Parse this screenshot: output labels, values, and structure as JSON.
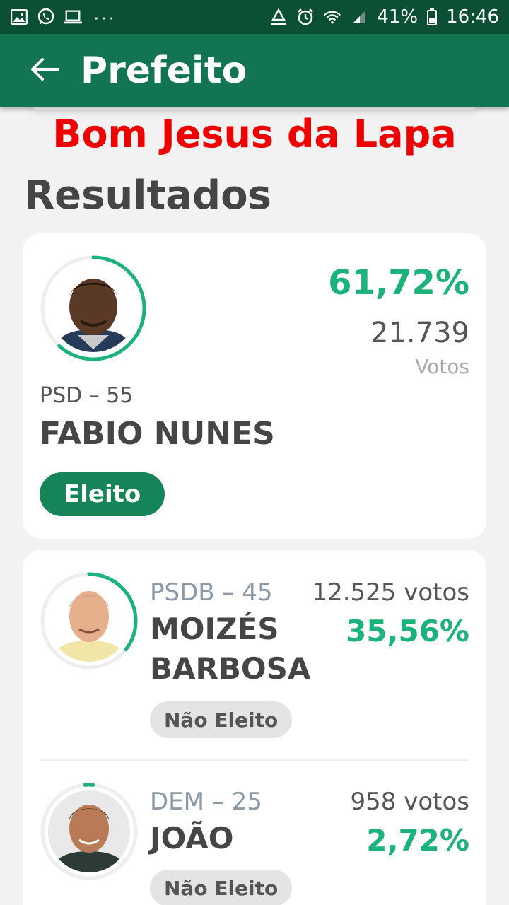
{
  "status_bar": {
    "battery": "41%",
    "time": "16:46",
    "left_icons": [
      "image-icon",
      "whatsapp-icon",
      "laptop-icon",
      "more-dots-icon"
    ],
    "right_icons": [
      "recycle-icon",
      "alarm-icon",
      "wifi-icon",
      "signal-icon",
      "battery-icon"
    ]
  },
  "app_bar": {
    "title": "Prefeito",
    "back_icon": "arrow-left-icon"
  },
  "city": "Bom Jesus da Lapa",
  "section_title": "Resultados",
  "colors": {
    "accent_green": "#1bb37a",
    "app_bar": "#137452",
    "status_bar": "#0b4f35",
    "city_red": "#ee0000",
    "elected_badge": "#168459"
  },
  "winner": {
    "percent": "61,72%",
    "percent_value": 61.72,
    "votes": "21.739",
    "votes_label": "Votos",
    "party": "PSD – 55",
    "name": "FABIO NUNES",
    "status": "Eleito"
  },
  "candidates": [
    {
      "party": "PSDB – 45",
      "name": "MOIZÉS BARBOSA",
      "votes": "12.525 votos",
      "percent": "35,56%",
      "percent_value": 35.56,
      "status": "Não Eleito"
    },
    {
      "party": "DEM – 25",
      "name": "JOÃO",
      "votes": "958 votos",
      "percent": "2,72%",
      "percent_value": 2.72,
      "status": "Não Eleito"
    }
  ]
}
